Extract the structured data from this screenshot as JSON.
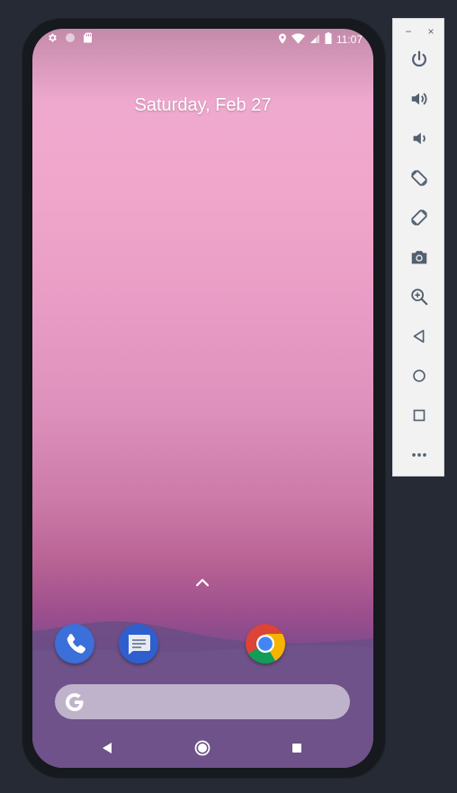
{
  "status_bar": {
    "time": "11:07",
    "left_icons": [
      "settings-icon",
      "sync-circle-icon",
      "sd-card-icon"
    ],
    "right_icons": [
      "location-icon",
      "wifi-icon",
      "cell-signal-icon",
      "battery-icon"
    ]
  },
  "home": {
    "date": "Saturday, Feb 27",
    "dock": [
      {
        "name": "Phone",
        "icon": "phone-icon",
        "color": "#3367d6"
      },
      {
        "name": "Messages",
        "icon": "messages-icon",
        "color": "#2f5fcf"
      },
      {
        "name": "Chrome",
        "icon": "chrome-icon",
        "color": "#4285f4"
      }
    ],
    "search_icon": "google-g-icon"
  },
  "nav_bar": {
    "buttons": [
      "back-icon",
      "home-icon",
      "recents-icon"
    ]
  },
  "toolbar": {
    "window_controls": [
      "minimize",
      "close"
    ],
    "minimize_label": "−",
    "close_label": "×",
    "buttons": [
      "power",
      "volume-up",
      "volume-down",
      "rotate-left",
      "rotate-right",
      "screenshot",
      "zoom",
      "back",
      "home",
      "overview",
      "more"
    ]
  },
  "colors": {
    "background": "#262a35",
    "toolbar_icon": "#52606f",
    "wallpaper_top": "#f0a6ca",
    "wallpaper_bottom": "#6e4f8a"
  }
}
